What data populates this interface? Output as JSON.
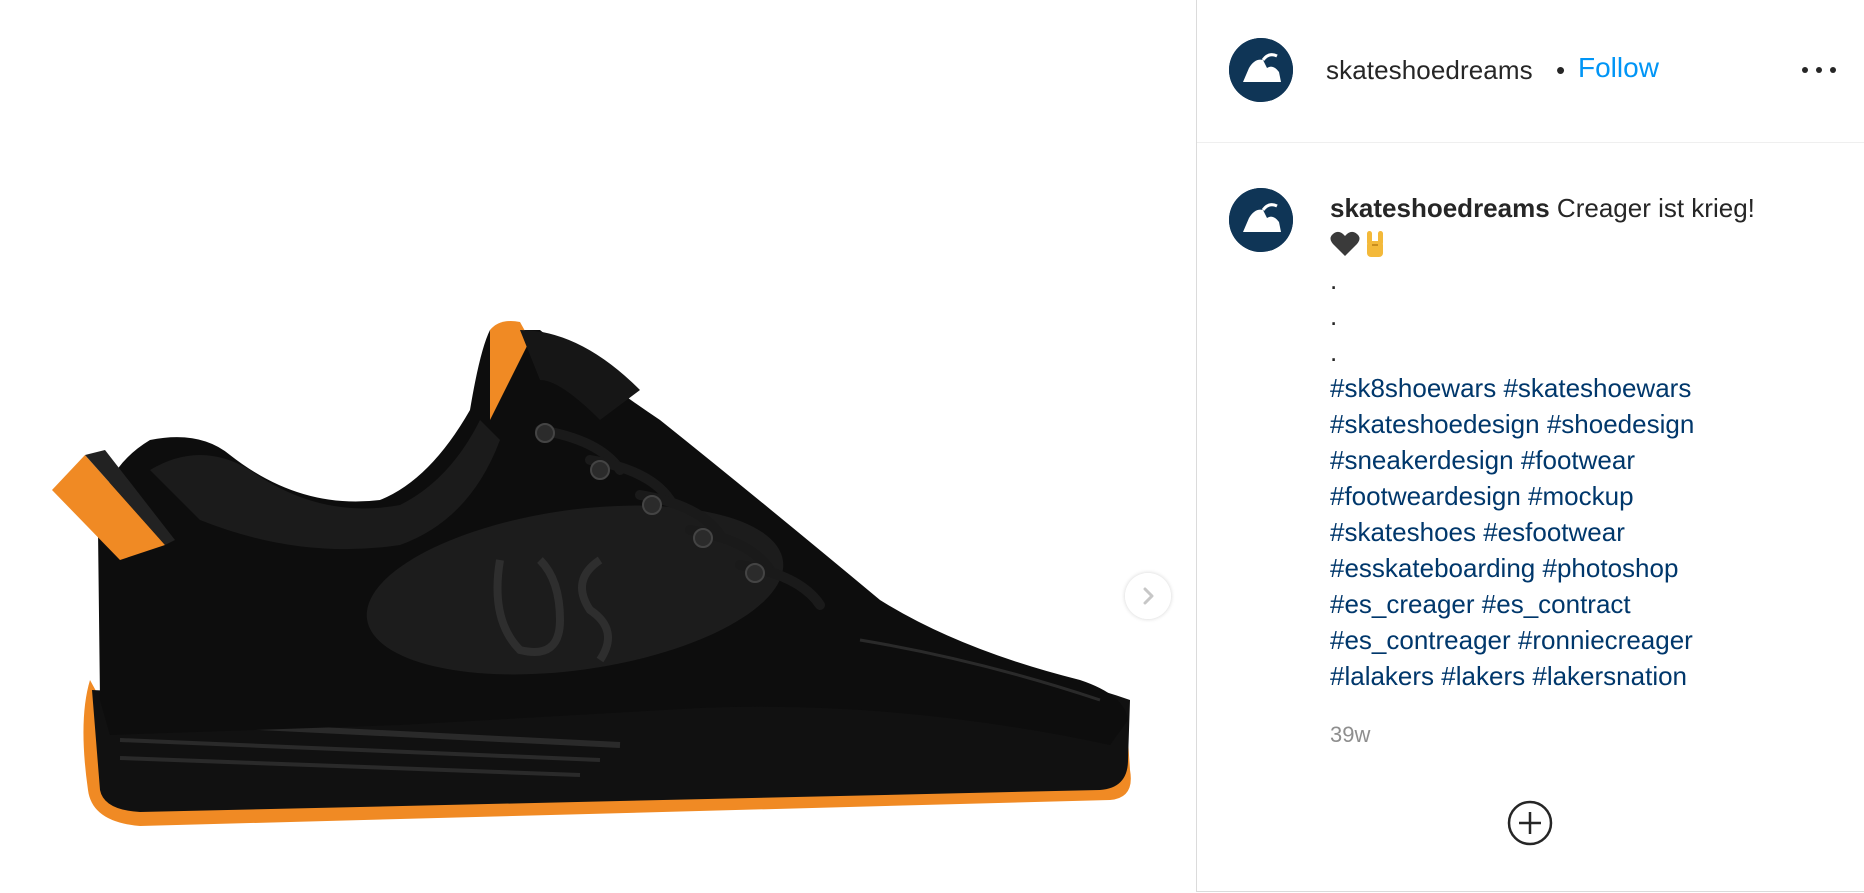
{
  "post": {
    "image_alt": "black and orange skate shoe mockup",
    "next_icon": "chevron-right-icon"
  },
  "header": {
    "username": "skateshoedreams",
    "separator": "•",
    "follow_label": "Follow",
    "more_icon": "more-options-icon"
  },
  "caption": {
    "username": "skateshoedreams",
    "text": "Creager ist krieg!",
    "emojis": [
      "black-heart-icon",
      "sign-of-the-horns-icon"
    ],
    "dots": [
      ".",
      ".",
      "."
    ],
    "hashtags": [
      "#sk8shoewars",
      "#skateshoewars",
      "#skateshoedesign",
      "#shoedesign",
      "#sneakerdesign",
      "#footwear",
      "#footweardesign",
      "#mockup",
      "#skateshoes",
      "#esfootwear",
      "#esskateboarding",
      "#photoshop",
      "#es_creager",
      "#es_contract",
      "#es_contreager",
      "#ronniecreager",
      "#lalakers",
      "#lakers",
      "#lakersnation"
    ],
    "hashtag_lines": [
      [
        0,
        1
      ],
      [
        2,
        3
      ],
      [
        4,
        5
      ],
      [
        6,
        7
      ],
      [
        8,
        9
      ],
      [
        10,
        11
      ],
      [
        12,
        13
      ],
      [
        14,
        15
      ],
      [
        16,
        17,
        18
      ]
    ]
  },
  "meta": {
    "timestamp": "39w",
    "add_comment_icon": "add-circle-icon"
  },
  "colors": {
    "link_blue": "#0095f6",
    "hashtag": "#00376b",
    "text": "#262626",
    "muted": "#8e8e8e",
    "avatar_bg": "#0f3556",
    "shoe_accent": "#f08a24"
  }
}
